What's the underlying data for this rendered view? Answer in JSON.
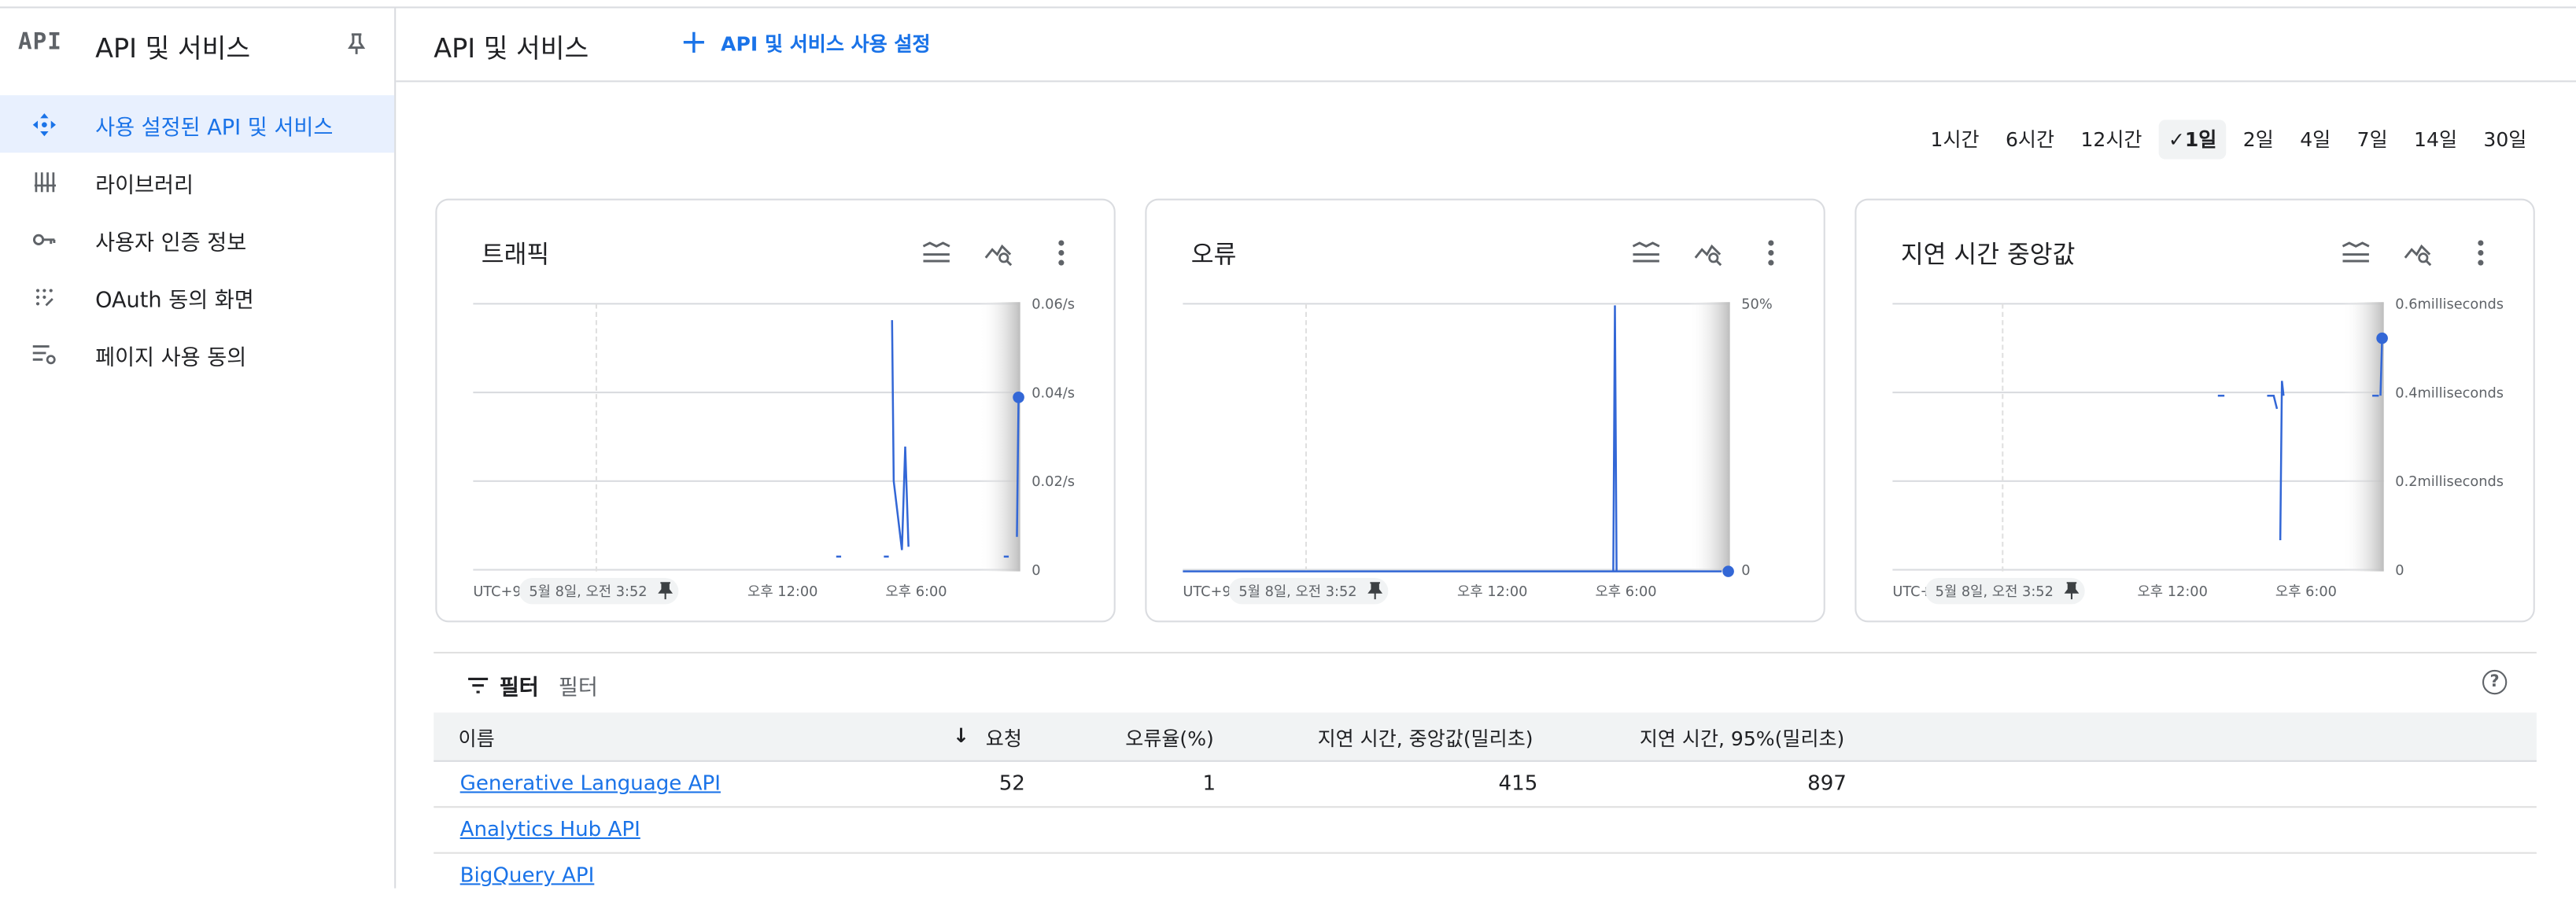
{
  "sidebar": {
    "logo": "API",
    "title": "API 및 서비스",
    "items": [
      {
        "label": "사용 설정된 API 및 서비스"
      },
      {
        "label": "라이브러리"
      },
      {
        "label": "사용자 인증 정보"
      },
      {
        "label": "OAuth 동의 화면"
      },
      {
        "label": "페이지 사용 동의"
      }
    ]
  },
  "header": {
    "title": "API 및 서비스",
    "enable_label": "API 및 서비스 사용 설정"
  },
  "time_ranges": [
    "1시간",
    "6시간",
    "12시간",
    "1일",
    "2일",
    "4일",
    "7일",
    "14일",
    "30일"
  ],
  "selected_range": "1일",
  "charts": [
    {
      "title": "트래픽",
      "yticks": [
        "0.06/s",
        "0.04/s",
        "0.02/s",
        "0"
      ],
      "xticks": [
        "오후 12:00",
        "오후 6:00"
      ],
      "tz": "UTC+9",
      "timestamp": "5월 8일, 오전 3:52"
    },
    {
      "title": "오류",
      "yticks": [
        "50%",
        "0"
      ],
      "xticks": [
        "오후 12:00",
        "오후 6:00"
      ],
      "tz": "UTC+9",
      "timestamp": "5월 8일, 오전 3:52"
    },
    {
      "title": "지연 시간 중앙값",
      "yticks": [
        "0.6milliseconds",
        "0.4milliseconds",
        "0.2milliseconds",
        "0"
      ],
      "xticks": [
        "오후 12:00",
        "오후 6:00"
      ],
      "tz": "UTC+",
      "timestamp": "5월 8일, 오전 3:52"
    }
  ],
  "filter": {
    "label": "필터",
    "placeholder": "필터"
  },
  "table": {
    "columns": [
      "이름",
      "요청",
      "오류율(%)",
      "지연 시간, 중앙값(밀리초)",
      "지연 시간, 95%(밀리초)"
    ],
    "rows": [
      {
        "name": "Generative Language API",
        "requests": "52",
        "error_rate": "1",
        "latency_median": "415",
        "latency_95": "897"
      },
      {
        "name": "Analytics Hub API",
        "requests": "",
        "error_rate": "",
        "latency_median": "",
        "latency_95": ""
      },
      {
        "name": "BigQuery API",
        "requests": "",
        "error_rate": "",
        "latency_median": "",
        "latency_95": ""
      }
    ]
  },
  "colors": {
    "accent": "#1a73e8",
    "line": "#3367d6",
    "active_bg": "#e8f0fe"
  },
  "icons": [
    "api-logo",
    "pin-icon",
    "services-icon",
    "library-icon",
    "key-icon",
    "oauth-icon",
    "page-settings-icon",
    "plus-icon",
    "legend-icon",
    "explore-icon",
    "more-vert-icon",
    "filter-icon",
    "help-icon",
    "sort-down-icon"
  ]
}
